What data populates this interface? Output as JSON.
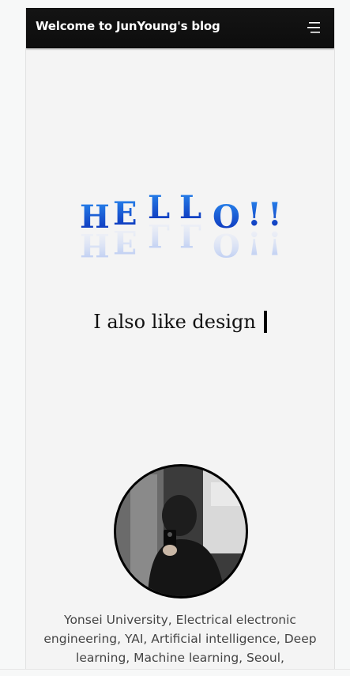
{
  "navbar": {
    "brand": "Welcome to JunYoung's blog",
    "menu_icon": "hamburger-menu-icon"
  },
  "hero": {
    "letters": [
      "H",
      "E",
      "L",
      "L",
      "O",
      "!",
      "!"
    ],
    "typing_text": "I also like design"
  },
  "profile": {
    "avatar_icon": "profile-photo",
    "bio": "Yonsei University, Electrical electronic engineering, YAI, Artificial intelligence, Deep learning, Machine learning, Seoul,"
  },
  "colors": {
    "navbar_bg": "#111111",
    "hello_top": "#1f7ae0",
    "hello_bottom": "#0b2fb8",
    "page_bg": "#f4f4f4"
  }
}
